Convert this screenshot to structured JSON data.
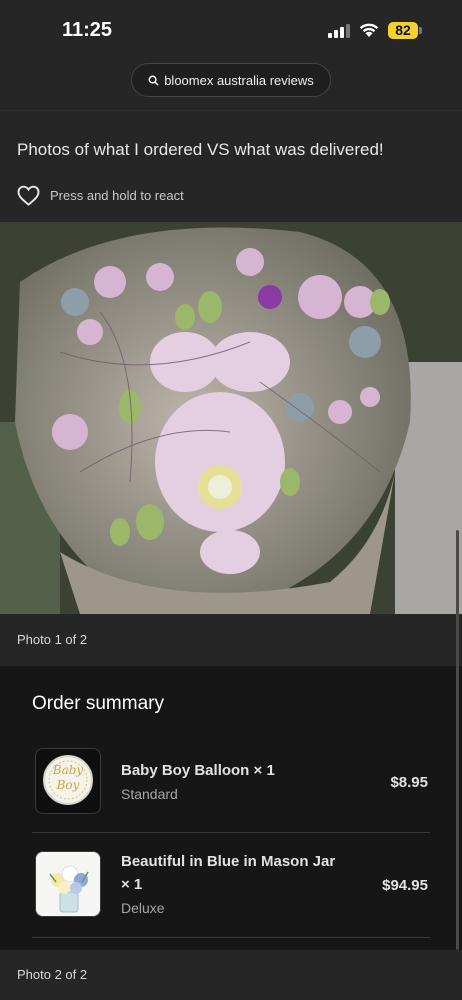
{
  "status": {
    "time": "11:25",
    "battery": "82",
    "icons": [
      "signal-icon",
      "wifi-icon",
      "battery-icon"
    ]
  },
  "search": {
    "query": "bloomex australia reviews"
  },
  "post": {
    "title": "Photos of what I ordered VS what was delivered!",
    "react_label": "Press and hold to react",
    "photo1_caption": "Photo 1 of 2",
    "photo2_caption": "Photo 2 of 2"
  },
  "order": {
    "title": "Order summary",
    "items": [
      {
        "name": "Baby Boy Balloon × 1",
        "variant": "Standard",
        "price": "$8.95",
        "thumb_text": "Baby Boy"
      },
      {
        "name": "Beautiful in Blue in Mason Jar × 1",
        "variant": "Deluxe",
        "price": "$94.95"
      }
    ]
  },
  "colors": {
    "background": "#262626",
    "order_panel": "#161616",
    "battery": "#f4d22e"
  }
}
